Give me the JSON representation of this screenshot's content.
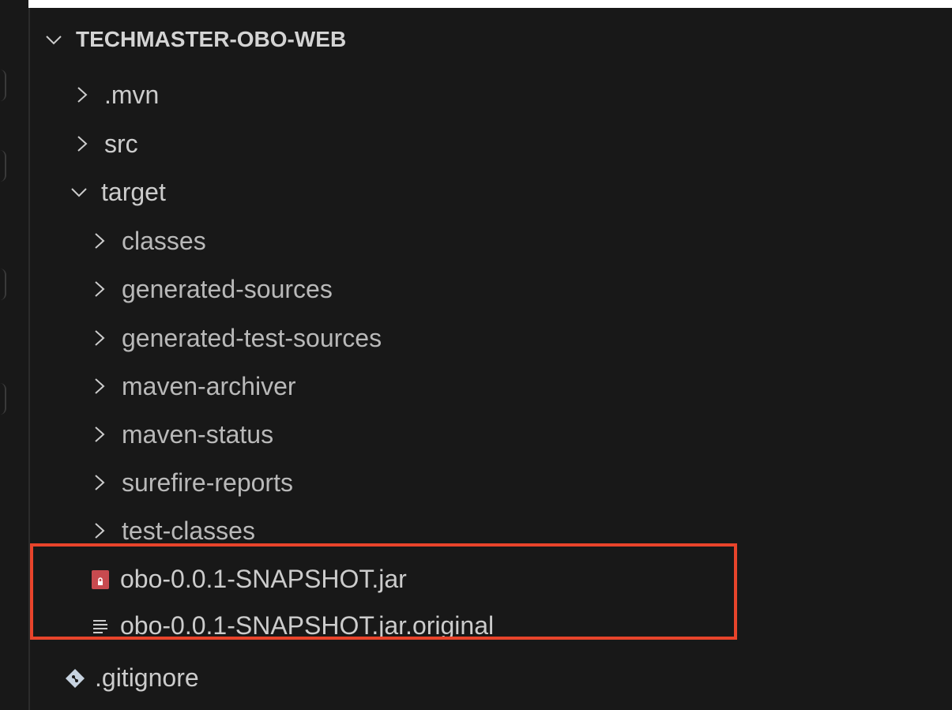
{
  "explorer": {
    "root_label": "TECHMASTER-OBO-WEB",
    "items": [
      {
        "label": ".mvn",
        "type": "folder",
        "expanded": false,
        "depth": 1
      },
      {
        "label": "src",
        "type": "folder",
        "expanded": false,
        "depth": 1
      },
      {
        "label": "target",
        "type": "folder",
        "expanded": true,
        "depth": 1
      },
      {
        "label": "classes",
        "type": "folder",
        "expanded": false,
        "depth": 2
      },
      {
        "label": "generated-sources",
        "type": "folder",
        "expanded": false,
        "depth": 2
      },
      {
        "label": "generated-test-sources",
        "type": "folder",
        "expanded": false,
        "depth": 2
      },
      {
        "label": "maven-archiver",
        "type": "folder",
        "expanded": false,
        "depth": 2
      },
      {
        "label": "maven-status",
        "type": "folder",
        "expanded": false,
        "depth": 2
      },
      {
        "label": "surefire-reports",
        "type": "folder",
        "expanded": false,
        "depth": 2
      },
      {
        "label": "test-classes",
        "type": "folder",
        "expanded": false,
        "depth": 2
      },
      {
        "label": "obo-0.0.1-SNAPSHOT.jar",
        "type": "file",
        "icon": "jar-file-icon",
        "depth": 2
      },
      {
        "label": "obo-0.0.1-SNAPSHOT.jar.original",
        "type": "file",
        "icon": "text-file-icon",
        "depth": 2
      },
      {
        "label": ".gitignore",
        "type": "file",
        "icon": "git-icon",
        "depth": 1
      }
    ]
  },
  "colors": {
    "background": "#181818",
    "highlight_border": "#e8442b",
    "jar_icon": "#c84a4f",
    "git_icon": "#c7d3e0"
  }
}
